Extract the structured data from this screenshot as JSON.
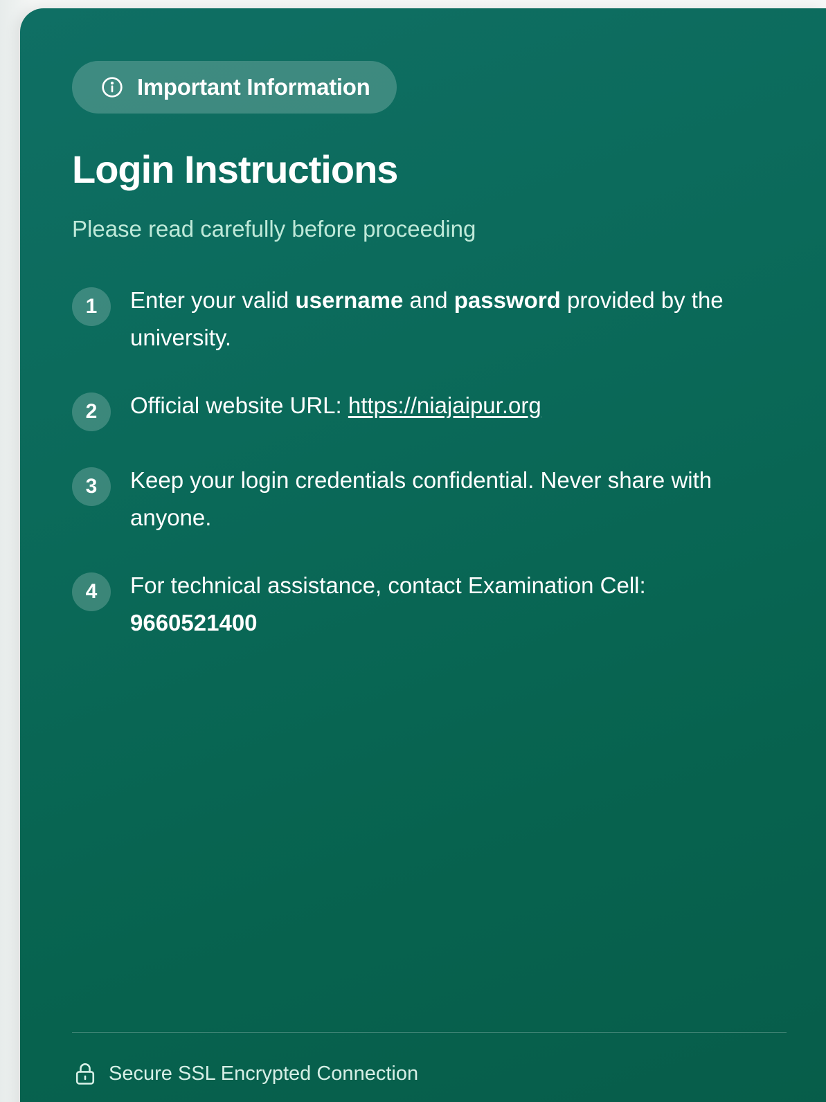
{
  "badge": {
    "icon": "info-icon",
    "label": "Important Information"
  },
  "title": "Login Instructions",
  "subtitle": "Please read carefully before proceeding",
  "steps": [
    {
      "number": "1",
      "text_1": "Enter your valid ",
      "bold_1": "username",
      "text_2": " and ",
      "bold_2": "password",
      "text_3": " provided by the university."
    },
    {
      "number": "2",
      "text_1": "Official website URL: ",
      "link": "https://niajaipur.org"
    },
    {
      "number": "3",
      "text_1": "Keep your login credentials confidential. Never share with anyone."
    },
    {
      "number": "4",
      "text_1": "For technical assistance, contact Examination Cell: ",
      "phone": "9660521400"
    }
  ],
  "footer": {
    "icon": "lock-icon",
    "label": "Secure SSL Encrypted Connection"
  },
  "colors": {
    "panel_start": "#0f6f64",
    "panel_end": "#075d4a",
    "subtitle": "#bfe9d9"
  }
}
